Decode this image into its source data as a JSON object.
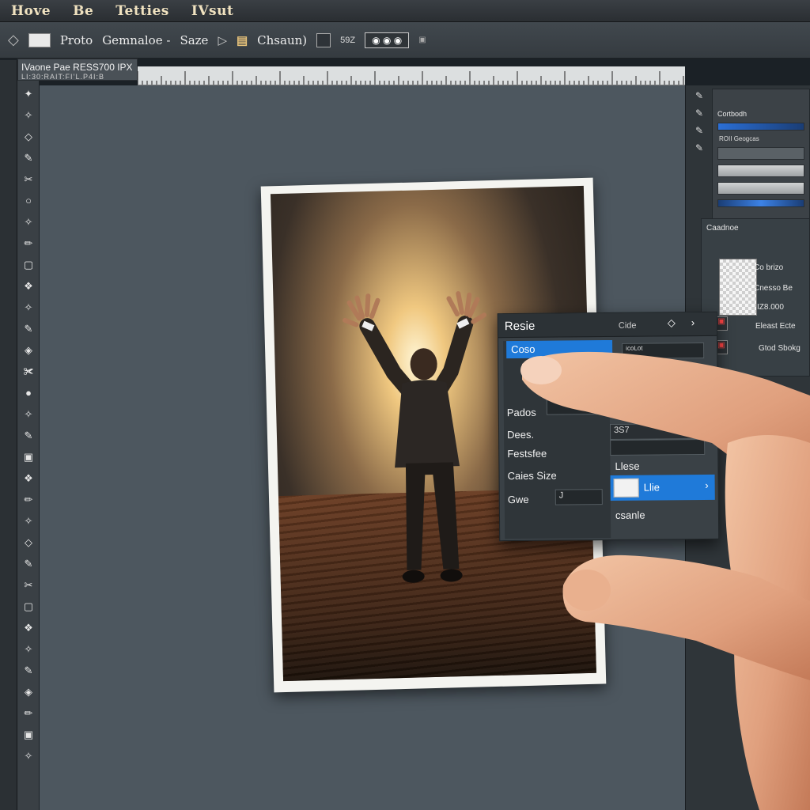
{
  "menu": {
    "items": [
      "Hove",
      "Be",
      "Tetties",
      "IVsut"
    ]
  },
  "options_bar": {
    "label1": "Proto",
    "label2": "Gemnaloe -",
    "label3": "Saze",
    "label4": "Chsaun)",
    "label5": "59Z"
  },
  "doc_tab": {
    "title": "IVaone Pae RESS700",
    "suffix": "IPX",
    "sub": "LI:30:RAIT:FI’L.P4I:B"
  },
  "right_panel": {
    "header": "Cortbodh",
    "sub": "ROII",
    "sub2": "Geogcas",
    "label_a": "Caadnoe",
    "layer1": "Co brizo",
    "layer2": "Cnesso Be",
    "layer3": "IZ8.000",
    "layer4": "Eleast Ecte",
    "layer5": "Gtod Sbokg"
  },
  "dialog": {
    "title": "Resie",
    "header_right": "Cide",
    "selected": "Coso",
    "rows": [
      "Pados",
      "Dees.",
      "Festsfee",
      "Caies Size",
      "Gwe"
    ],
    "right_label_1": "Llese",
    "right_selected": "Llie",
    "right_label_2": "csanle",
    "field_label": "icoLot",
    "gwe_value": "J",
    "field_value": "3S7"
  }
}
